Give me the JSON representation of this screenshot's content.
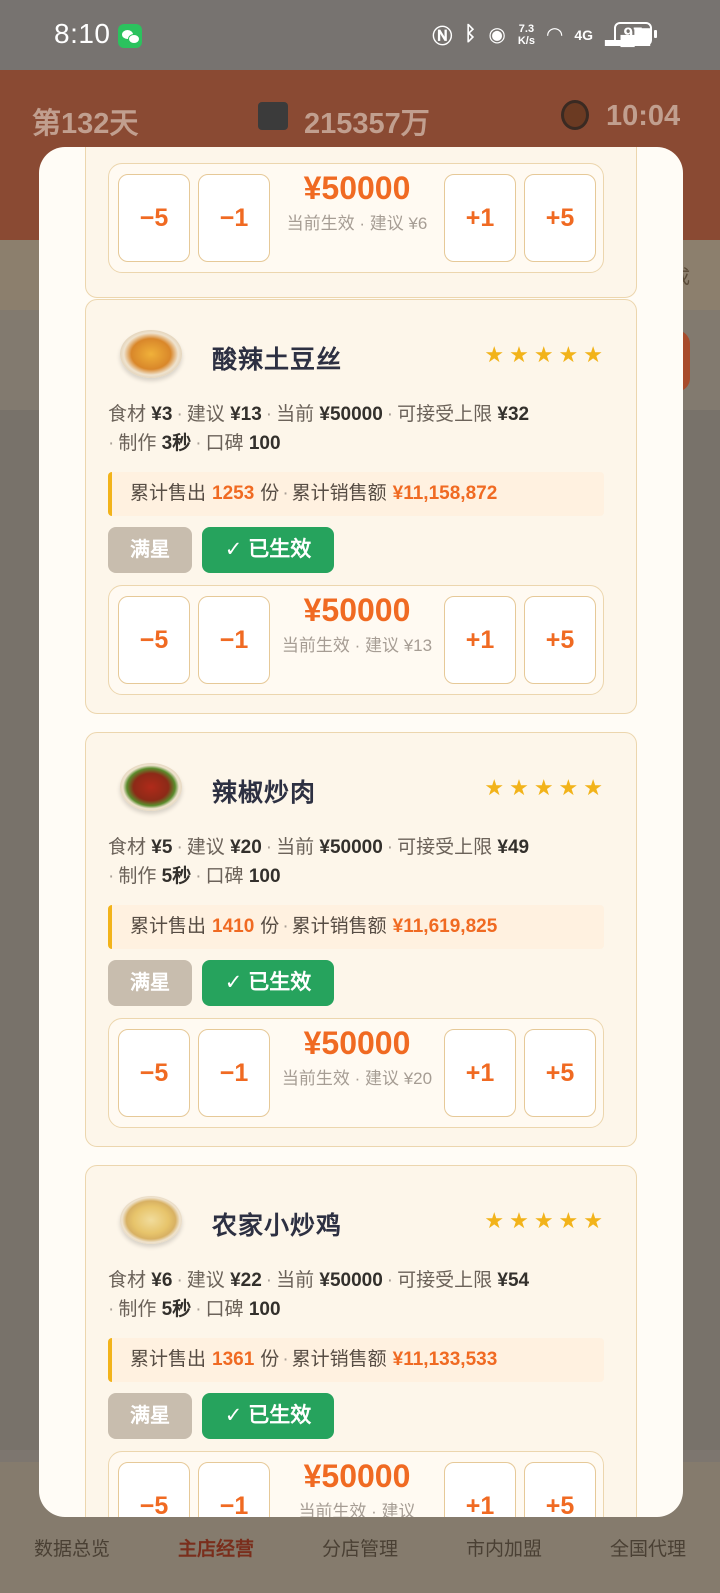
{
  "status_bar": {
    "time": "8:10",
    "net_speed_top": "7.3",
    "net_speed_bottom": "K/s",
    "network": "4G",
    "battery": "97"
  },
  "game_header": {
    "day": "第132天",
    "money": "215357万",
    "clock": "10:04"
  },
  "background": {
    "edge_text": "成"
  },
  "top_card": {
    "price": "¥50000",
    "note": "当前生效 · 建议 ¥6",
    "buttons": [
      "−5",
      "−1",
      "+1",
      "+5"
    ]
  },
  "dishes": [
    {
      "name": "酸辣土豆丝",
      "stars": "★★★★★",
      "food_cost": "¥3",
      "suggest": "¥13",
      "current": "¥50000",
      "limit": "¥32",
      "make_time": "3秒",
      "reputation": "100",
      "sold": "1253",
      "revenue": "¥11,158,872",
      "tag_full": "满星",
      "tag_active": "✓ 已生效",
      "price": "¥50000",
      "note": "当前生效 · 建议 ¥13"
    },
    {
      "name": "辣椒炒肉",
      "stars": "★★★★★",
      "food_cost": "¥5",
      "suggest": "¥20",
      "current": "¥50000",
      "limit": "¥49",
      "make_time": "5秒",
      "reputation": "100",
      "sold": "1410",
      "revenue": "¥11,619,825",
      "tag_full": "满星",
      "tag_active": "✓ 已生效",
      "price": "¥50000",
      "note": "当前生效 · 建议 ¥20"
    },
    {
      "name": "农家小炒鸡",
      "stars": "★★★★★",
      "food_cost": "¥6",
      "suggest": "¥22",
      "current": "¥50000",
      "limit": "¥54",
      "make_time": "5秒",
      "reputation": "100",
      "sold": "1361",
      "revenue": "¥11,133,533",
      "tag_full": "满星",
      "tag_active": "✓ 已生效",
      "price": "¥50000",
      "note": "当前生效 · 建议"
    }
  ],
  "labels": {
    "food": "食材",
    "suggest": "建议",
    "current": "当前",
    "limit": "可接受上限",
    "make": "制作",
    "reputation": "口碑",
    "sold": "累计售出",
    "unit": "份",
    "revenue": "累计销售额",
    "btn_m5": "−5",
    "btn_m1": "−1",
    "btn_p1": "+1",
    "btn_p5": "+5"
  },
  "bottom_nav": [
    {
      "label": "数据总览"
    },
    {
      "label": "主店经营"
    },
    {
      "label": "分店管理"
    },
    {
      "label": "市内加盟"
    },
    {
      "label": "全国代理"
    }
  ]
}
